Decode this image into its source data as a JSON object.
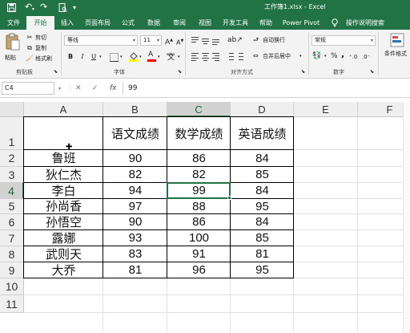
{
  "titlebar": {
    "undo_icon": "undo-arrow-icon",
    "redo_icon": "redo-arrow-icon",
    "title": "工作簿1.xlsx  -  Excel"
  },
  "tabs": [
    {
      "label": "文件"
    },
    {
      "label": "开始"
    },
    {
      "label": "插入"
    },
    {
      "label": "页面布局"
    },
    {
      "label": "公式"
    },
    {
      "label": "数据"
    },
    {
      "label": "审阅"
    },
    {
      "label": "视图"
    },
    {
      "label": "开发工具"
    },
    {
      "label": "帮助"
    },
    {
      "label": "Power Pivot"
    }
  ],
  "active_tab": "开始",
  "tell_me": "操作说明搜索",
  "ribbon": {
    "clipboard": {
      "paste": "粘贴",
      "cut": "剪切",
      "copy": "复制",
      "format_painter": "格式刷",
      "group_label": "剪贴板"
    },
    "font": {
      "font_name": "等线",
      "font_size": "11",
      "group_label": "字体",
      "bold": "B",
      "italic": "I",
      "underline": "U",
      "font_color_letter": "A",
      "wen": "wén"
    },
    "alignment": {
      "wrap_text": "自动换行",
      "merge_center": "合并后居中",
      "group_label": "对齐方式"
    },
    "number": {
      "format": "常规",
      "percent": "%",
      "comma": ",",
      "group_label": "数字"
    },
    "styles": {
      "conditional_format": "条件格式"
    }
  },
  "formula_bar": {
    "name_box": "C4",
    "cancel": "✕",
    "enter": "✓",
    "fx": "fx",
    "value": "99"
  },
  "sheet": {
    "columns": [
      "A",
      "B",
      "C",
      "D",
      "E",
      "F"
    ],
    "rows": [
      "1",
      "2",
      "3",
      "4",
      "5",
      "6",
      "7",
      "8",
      "9",
      "10",
      "11"
    ],
    "selected_column": "C",
    "selected_row": "4",
    "headers": [
      "语文成绩",
      "数学成绩",
      "英语成绩"
    ],
    "records": [
      {
        "name": "鲁班",
        "chinese": "90",
        "math": "86",
        "english": "84"
      },
      {
        "name": "狄仁杰",
        "chinese": "82",
        "math": "82",
        "english": "85"
      },
      {
        "name": "李白",
        "chinese": "94",
        "math": "99",
        "english": "84"
      },
      {
        "name": "孙尚香",
        "chinese": "97",
        "math": "88",
        "english": "95"
      },
      {
        "name": "孙悟空",
        "chinese": "90",
        "math": "86",
        "english": "84"
      },
      {
        "name": "露娜",
        "chinese": "93",
        "math": "100",
        "english": "85"
      },
      {
        "name": "武则天",
        "chinese": "83",
        "math": "91",
        "english": "81"
      },
      {
        "name": "大乔",
        "chinese": "81",
        "math": "96",
        "english": "95"
      }
    ]
  },
  "colors": {
    "excel_green": "#217346",
    "ribbon_bg": "#f3f3f3",
    "header_bg": "#efefef"
  }
}
